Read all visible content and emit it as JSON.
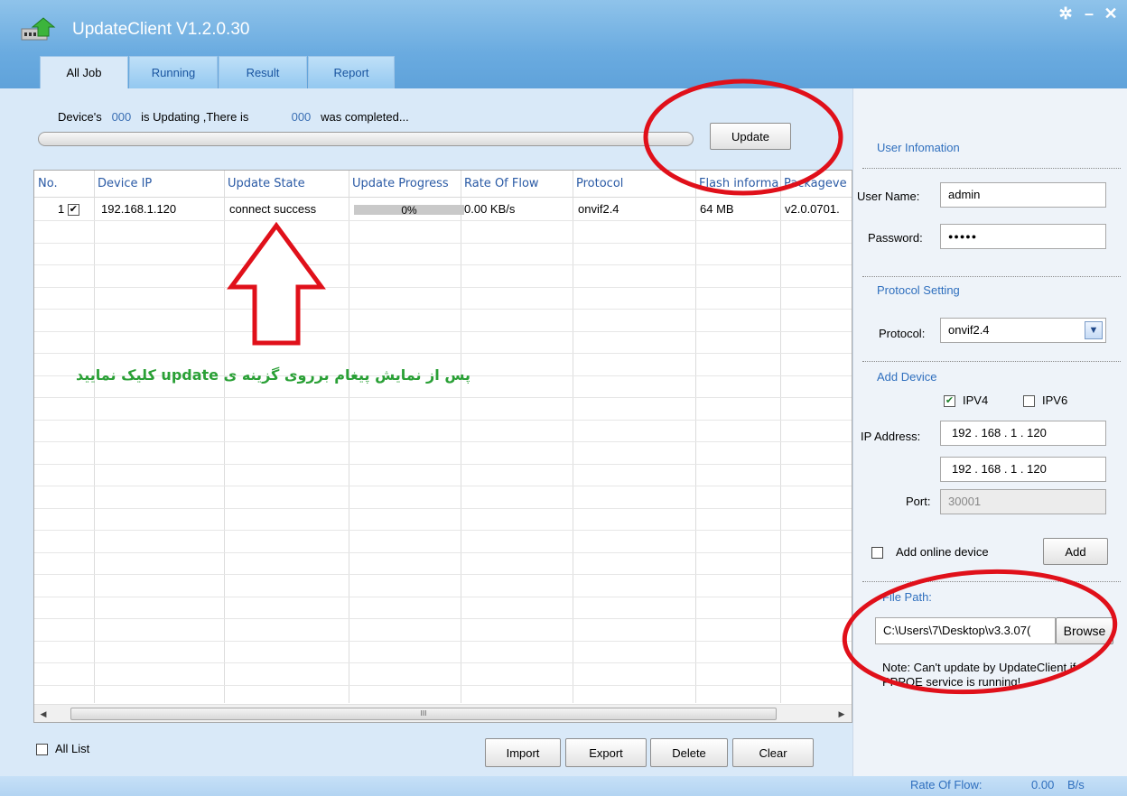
{
  "window": {
    "title": "UpdateClient V1.2.0.30",
    "controls": {
      "settings": "✲",
      "minimize": "–",
      "close": "✕"
    }
  },
  "tabs": [
    {
      "label": "All Job",
      "active": true
    },
    {
      "label": "Running",
      "active": false
    },
    {
      "label": "Result",
      "active": false
    },
    {
      "label": "Report",
      "active": false
    }
  ],
  "status": {
    "prefix": "Device's",
    "updating_count": "000",
    "middle": "is Updating ,There is",
    "completed_count": "000",
    "suffix": "was completed..."
  },
  "update_button": "Update",
  "grid": {
    "columns": [
      "No.",
      "Device IP",
      "Update State",
      "Update Progress",
      "Rate Of Flow",
      "Protocol",
      "Flash informa",
      "Packageve"
    ],
    "rows": [
      {
        "no": "1",
        "checked": "✔",
        "ip": "192.168.1.120",
        "state": "connect success",
        "progress": "0%",
        "progress_value": 0,
        "rate": "0.00 KB/s",
        "protocol": "onvif2.4",
        "flash": "64 MB",
        "package": "v2.0.0701."
      }
    ],
    "scroll_grip": "III"
  },
  "bottom": {
    "all_list": "All List",
    "buttons": [
      "Import",
      "Export",
      "Delete",
      "Clear"
    ]
  },
  "user_info": {
    "title": "User Infomation",
    "username_label": "User Name:",
    "username": "admin",
    "password_label": "Password:",
    "password_mask": "●●●●●"
  },
  "protocol_setting": {
    "title": "Protocol Setting",
    "label": "Protocol:",
    "value": "onvif2.4"
  },
  "add_device": {
    "title": "Add Device",
    "ipv4_label": "IPV4",
    "ipv4_checked": "✔",
    "ipv6_label": "IPV6",
    "ip_label": "IP Address:",
    "ip_start": "192  .  168  .   1   .  120",
    "ip_end": "192  .  168  .   1   .  120",
    "port_label": "Port:",
    "port": "30001",
    "online_label": "Add online device",
    "add_button": "Add"
  },
  "file_path": {
    "title": "File Path:",
    "value": "C:\\Users\\7\\Desktop\\v3.3.07(",
    "browse_button": "Browse",
    "note": "Note: Can't update by UpdateClient,if PPPOE service is running!"
  },
  "statusbar": {
    "label": "Rate Of Flow:",
    "value": "0.00",
    "unit": "B/s"
  },
  "annotation": {
    "text": "پس از نمایش پیغام برروی گزینه ی update کلیک نمایید",
    "color": "#2aa036",
    "mark_color": "#e0101a"
  }
}
